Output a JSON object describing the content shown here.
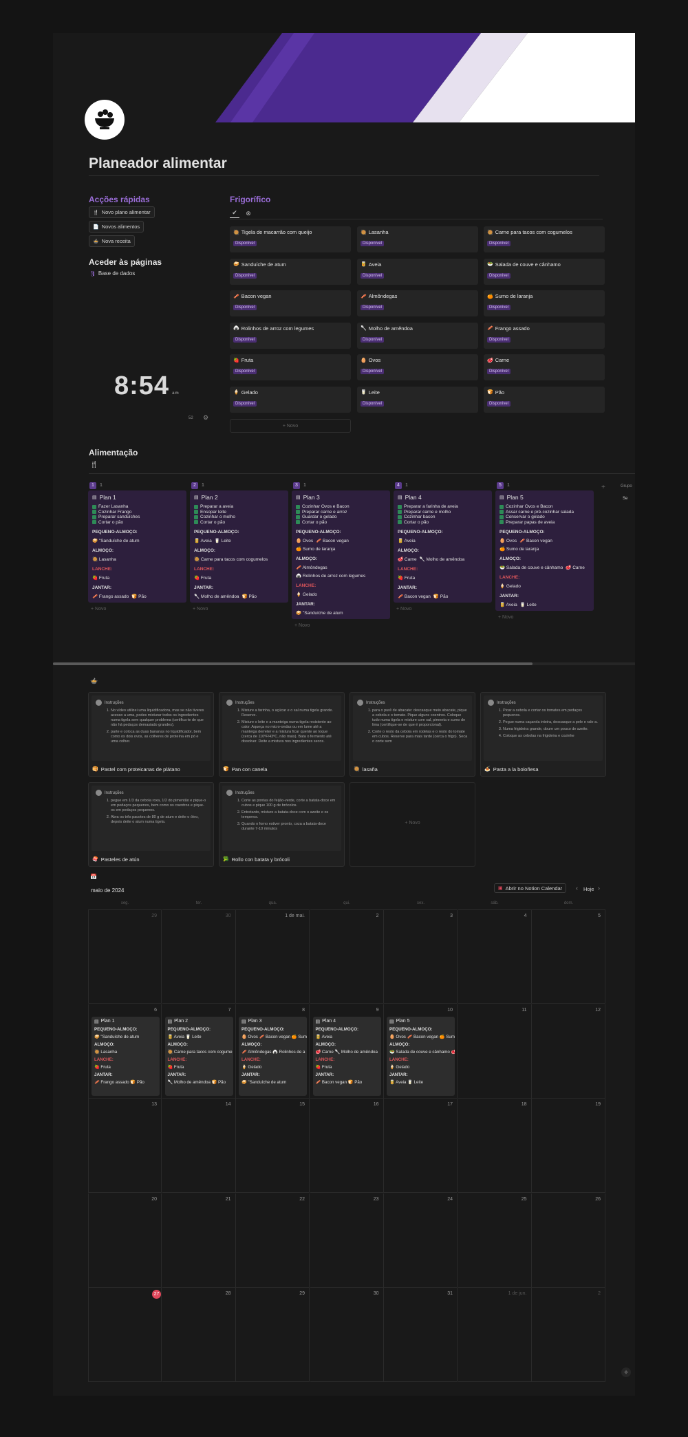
{
  "page": {
    "title": "Planeador alimentar"
  },
  "quick_actions": {
    "heading": "Acções rápidas",
    "buttons": [
      {
        "label": "Novo plano alimentar",
        "icon": "fork-knife-icon"
      },
      {
        "label": "Novos alimentos",
        "icon": "document-icon"
      },
      {
        "label": "Nova receita",
        "icon": "bowl-icon"
      }
    ]
  },
  "pages": {
    "heading": "Aceder às páginas",
    "links": [
      {
        "label": "Base de dados",
        "icon": "database-icon"
      }
    ]
  },
  "clock": {
    "time": "8:54",
    "suffix": "am",
    "weeknum": "52"
  },
  "fridge": {
    "heading": "Frigorífico",
    "badge": "Disponível",
    "new_label": "+ Novo",
    "items": [
      {
        "name": "Tigela de macarrão com queijo",
        "icon": "🥘"
      },
      {
        "name": "Lasanha",
        "icon": "🥘"
      },
      {
        "name": "Carne para tacos com cogumelos",
        "icon": "🥘"
      },
      {
        "name": "Sanduíche de atum",
        "icon": "🥪"
      },
      {
        "name": "Aveia",
        "icon": "🥫"
      },
      {
        "name": "Salada de couve e cânhamo",
        "icon": "🥗"
      },
      {
        "name": "Bacon vegan",
        "icon": "🥓"
      },
      {
        "name": "Almôndegas",
        "icon": "🥓"
      },
      {
        "name": "Sumo de laranja",
        "icon": "🍊"
      },
      {
        "name": "Rolinhos de arroz com legumes",
        "icon": "🍙"
      },
      {
        "name": "Molho de amêndoa",
        "icon": "🥄"
      },
      {
        "name": "Frango assado",
        "icon": "🥓"
      },
      {
        "name": "Fruta",
        "icon": "🍓"
      },
      {
        "name": "Ovos",
        "icon": "🥚"
      },
      {
        "name": "Carne",
        "icon": "🥩"
      },
      {
        "name": "Gelado",
        "icon": "🍦"
      },
      {
        "name": "Leite",
        "icon": "🥛"
      },
      {
        "name": "Pão",
        "icon": "🍞"
      }
    ]
  },
  "board": {
    "heading": "Alimentação",
    "new_label": "+ Novo",
    "sections": {
      "breakfast": "PEQUENO-ALMOÇO:",
      "lunch": "ALMOÇO:",
      "snack": "LANCHE:",
      "dinner": "JANTAR:"
    },
    "plans": [
      {
        "num": "1",
        "count": "1",
        "title": "Plan 1",
        "tasks": [
          "Fazer Lasanha",
          "Cozinhar Frango",
          "Preparar sanduíches",
          "Cortar o pão"
        ],
        "breakfast": [
          "🥪 \"Sanduíche de atum"
        ],
        "lunch": [
          "🥘 Lasanha"
        ],
        "snack": [
          "🍓 Fruta"
        ],
        "dinner": [
          "🥓 Frango assado",
          "🍞 Pão"
        ]
      },
      {
        "num": "2",
        "count": "1",
        "title": "Plan 2",
        "tasks": [
          "Preparar a aveia",
          "Ensopar leite",
          "Cozinhar o molho",
          "Cortar o pão"
        ],
        "breakfast": [
          "🥫 Aveia",
          "🥛 Leite"
        ],
        "lunch": [
          "🥘 Carne para tacos com cogumelos"
        ],
        "snack": [
          "🍓 Fruta"
        ],
        "dinner": [
          "🥄 Molho de amêndoa",
          "🍞 Pão"
        ]
      },
      {
        "num": "3",
        "count": "1",
        "title": "Plan 3",
        "tasks": [
          "Cozinhar Ovos e Bacon",
          "Preparar carne e arroz",
          "Guardar o gelado",
          "Cortar o pão"
        ],
        "breakfast": [
          "🥚 Ovos",
          "🥓 Bacon vegan",
          "🍊 Sumo de laranja"
        ],
        "lunch": [
          "🥓 Almôndegas",
          "🍙 Rolinhos de arroz com legumes"
        ],
        "snack": [
          "🍦 Gelado"
        ],
        "dinner": [
          "🥪 \"Sanduíche de atum"
        ]
      },
      {
        "num": "4",
        "count": "1",
        "title": "Plan 4",
        "tasks": [
          "Preparar a farinha de aveia",
          "Preparar carne e molho",
          "Cozinhar bacon",
          "Cortar o pão"
        ],
        "breakfast": [
          "🥫 Aveia"
        ],
        "lunch": [
          "🥩 Carne",
          "🥄 Molho de amêndoa"
        ],
        "snack": [
          "🍓 Fruta"
        ],
        "dinner": [
          "🥓 Bacon vegan",
          "🍞 Pão"
        ]
      },
      {
        "num": "5",
        "count": "1",
        "title": "Plan 5",
        "tasks": [
          "Cozinhar Ovos e Bacon",
          "Assar carne e pré-cozinhar salada",
          "Conservar o gelado",
          "Preparar papas de aveia"
        ],
        "breakfast": [
          "🥚 Ovos",
          "🥓 Bacon vegan",
          "🍊 Sumo de laranja"
        ],
        "lunch": [
          "🥗 Salada de couve e cânhamo",
          "🥩 Carne"
        ],
        "snack": [
          "🍦 Gelado"
        ],
        "dinner": [
          "🥫 Aveia",
          "🥛 Leite"
        ]
      }
    ],
    "hidden_group": {
      "label": "Grupo",
      "item": "Se"
    }
  },
  "recipes": {
    "instructions_label": "Instruções",
    "new_label": "+ Novo",
    "items": [
      {
        "title": "Pastel com proteicanas de plátano",
        "icon": "🥞",
        "steps": [
          "No vídeo utilizei uma liquidificadora, mas se não tiveres acesso a uma, podes misturar todos os ingredientes numa tigela sem qualquer problema (certifica-te de que não há pedaços demasiado grandes).",
          "parte e coloca as duas bananas no liquidificador, bem como os dois ovos, as colheres de proteína em pó e uma colher."
        ]
      },
      {
        "title": "Pan con canela",
        "icon": "🍞",
        "steps": [
          "Misture a farinha, o açúcar e o sal numa tigela grande. Reserve.",
          "Misture o leite e a manteiga numa tigela resistente ao calor. Aqueça no micro-ondas ou em lume até a manteiga derreter e a mistura ficar quente ao toque (cerca de 110ºF/43ºC, não mais). Bata o fermento até dissolver. Deite a mistura nos ingredientes secos."
        ]
      },
      {
        "title": "lasaña",
        "icon": "🥘",
        "steps": [
          "para o purê de abacate: descasque meio abacate, pique a cebola e o tomate. Pique alguns coentros. Coloque tudo numa tigela e misture com sal, pimenta e sumo de lima (certifique-se de que é proporcional).",
          "Corte o resto da cebola em rodelas e o resto do tomate em cubos. Reserve para mais tarde (cerca o frigo). Seca o corte sem"
        ]
      },
      {
        "title": "Pasta a la boloñesa",
        "icon": "🍝",
        "steps": [
          "Picar a cebola e cortar os tomates em pedaços pequenos.",
          "Pegue numa caçarola inteira, descasque a pele e rale-a.",
          "Numa frigideira grande, doure um pouco de azeite.",
          "Coloque as cebolas na frigideira e cozinhe"
        ]
      },
      {
        "title": "Pasteles de atún",
        "icon": "🍣",
        "steps": [
          "pegue em 1/3 da cebola roxa, 1/2 do pimentão e pique-o em pedaços pequenos, bem como os coentros e pique-os em pedaços pequenos.",
          "Abra os três pacotes de 80 g de atum e deite o óleo, depois deite o atum numa tigela."
        ]
      },
      {
        "title": "Rollo con batata y brócoli",
        "icon": "🥦",
        "steps": [
          "Corte as pontas do feijão-verde, corte a batata-doce em cubos e pique 100 g de brócolos.",
          "Entretanto, misture a batata-doce com o azeite e os temperos.",
          "Quando o forno estiver pronto, coza a batata-doce durante 7-10 minutos"
        ]
      }
    ]
  },
  "calendar": {
    "month": "maio de 2024",
    "open_label": "Abrir no Notion Calendar",
    "today_label": "Hoje",
    "weekdays": [
      "seg.",
      "ter.",
      "qua.",
      "qui.",
      "sex.",
      "sáb.",
      "dom."
    ],
    "weeks": [
      [
        "29",
        "30",
        "1 de mai.",
        "2",
        "3",
        "4",
        "5"
      ],
      [
        "6",
        "7",
        "8",
        "9",
        "10",
        "11",
        "12"
      ],
      [
        "13",
        "14",
        "15",
        "16",
        "17",
        "18",
        "19"
      ],
      [
        "20",
        "21",
        "22",
        "23",
        "24",
        "25",
        "26"
      ],
      [
        "27",
        "28",
        "29",
        "30",
        "31",
        "1 de jun.",
        "2"
      ]
    ],
    "events": [
      {
        "title": "Plan 1",
        "breakfast": "🥪 \"Sanduíche de atum",
        "lunch": "🥘 Lasanha",
        "snack": "🍓 Fruta",
        "dinner": "🥓 Frango assado  🍞 Pão"
      },
      {
        "title": "Plan 2",
        "breakfast": "🥫 Aveia  🥛 Leite",
        "lunch": "🥘 Carne para tacos com cogume",
        "snack": "🍓 Fruta",
        "dinner": "🥄 Molho de amêndoa  🍞 Pão"
      },
      {
        "title": "Plan 3",
        "breakfast": "🥚 Ovos  🥓 Bacon vegan  🍊 Sum",
        "lunch": "🥓 Almôndegas  🍙 Rolinhos de a",
        "snack": "🍦 Gelado",
        "dinner": "🥪 \"Sanduíche de atum"
      },
      {
        "title": "Plan 4",
        "breakfast": "🥫 Aveia",
        "lunch": "🥩 Carne  🥄 Molho de amêndoa",
        "snack": "🍓 Fruta",
        "dinner": "🥓 Bacon vegan  🍞 Pão"
      },
      {
        "title": "Plan 5",
        "breakfast": "🥚 Ovos  🥓 Bacon vegan  🍊 Sum",
        "lunch": "🥗 Salada de couve e cânhamo  🥩",
        "snack": "🍦 Gelado",
        "dinner": "🥫 Aveia  🥛 Leite"
      }
    ]
  },
  "colors": {
    "accent": "#9a6dd7",
    "plan_bg": "#2d1f3d",
    "badge_bg": "#4a2e72",
    "today": "#e0475b",
    "cover_purple": "#4b2a8f"
  }
}
